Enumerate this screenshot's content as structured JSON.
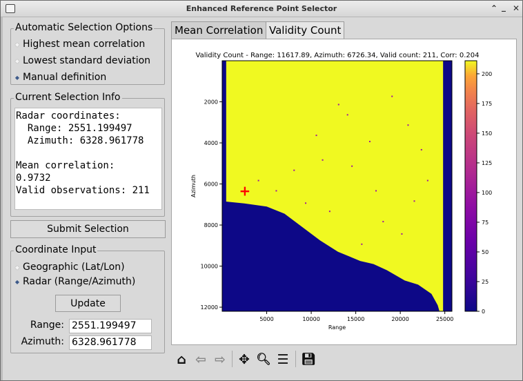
{
  "window": {
    "title": "Enhanced Reference Point Selector",
    "minimize": "⌃",
    "minimize2": "_",
    "close": "✕"
  },
  "auto_group": {
    "title": "Automatic Selection Options",
    "options": [
      {
        "label": "Highest mean correlation",
        "checked": false
      },
      {
        "label": "Lowest standard deviation",
        "checked": false
      },
      {
        "label": "Manual definition",
        "checked": true
      }
    ]
  },
  "info_group": {
    "title": "Current Selection Info",
    "lines": [
      "Radar coordinates:",
      "  Range: 2551.199497",
      "  Azimuth: 6328.961778",
      "",
      "Mean correlation:",
      "0.9732",
      "Valid observations: 211"
    ]
  },
  "submit_label": "Submit Selection",
  "coord_group": {
    "title": "Coordinate Input",
    "options": [
      {
        "label": "Geographic (Lat/Lon)",
        "checked": false
      },
      {
        "label": "Radar (Range/Azimuth)",
        "checked": true
      }
    ],
    "update_label": "Update",
    "range_label": "Range:",
    "range_value": "2551.199497",
    "azimuth_label": "Azimuth:",
    "azimuth_value": "6328.961778"
  },
  "tabs": [
    {
      "label": "Mean Correlation",
      "active": false
    },
    {
      "label": "Validity Count",
      "active": true
    }
  ],
  "plot": {
    "title": "Validity Count - Range: 11617.89, Azimuth: 6726.34, Valid count: 211, Corr: 0.204",
    "colormap": "plasma",
    "marker": {
      "range": 2551.2,
      "azimuth": 6329,
      "symbol": "+",
      "color": "#ff0000"
    }
  },
  "chart_data": {
    "type": "heatmap",
    "title": "Validity Count - Range: 11617.89, Azimuth: 6726.34, Valid count: 211, Corr: 0.204",
    "xlabel": "Range",
    "ylabel": "Azimuth",
    "xlim": [
      0,
      25800
    ],
    "ylim": [
      12200,
      0
    ],
    "x_ticks": [
      5000,
      10000,
      15000,
      20000,
      25000
    ],
    "y_ticks": [
      2000,
      4000,
      6000,
      8000,
      10000,
      12000
    ],
    "colorbar": {
      "range": [
        0,
        211
      ],
      "ticks": [
        0,
        25,
        50,
        75,
        100,
        125,
        150,
        175,
        200
      ]
    },
    "regions": [
      {
        "description": "valid area",
        "value": 211,
        "color": "#f0f921"
      },
      {
        "description": "invalid area (sea/borders)",
        "value": 0,
        "color": "#0d0887"
      }
    ],
    "coast_profile": [
      [
        300,
        6850
      ],
      [
        2500,
        6950
      ],
      [
        5000,
        7100
      ],
      [
        7000,
        7450
      ],
      [
        9000,
        8100
      ],
      [
        11000,
        8750
      ],
      [
        13000,
        9300
      ],
      [
        15500,
        9750
      ],
      [
        17000,
        9900
      ],
      [
        18500,
        10200
      ],
      [
        20500,
        10700
      ],
      [
        22000,
        10900
      ],
      [
        23500,
        11350
      ],
      [
        24200,
        11900
      ],
      [
        24400,
        12200
      ]
    ],
    "left_band_range": [
      0,
      450
    ],
    "right_band_range": [
      24800,
      25800
    ]
  },
  "toolbar": {
    "icons": [
      {
        "name": "home-icon",
        "glyph": "⌂"
      },
      {
        "name": "back-icon",
        "glyph": "⇦"
      },
      {
        "name": "forward-icon",
        "glyph": "⇨"
      },
      {
        "name": "pan-icon",
        "glyph": "✥"
      },
      {
        "name": "zoom-icon",
        "glyph": "🔍︎"
      },
      {
        "name": "configure-subplots-icon",
        "glyph": "☰"
      },
      {
        "name": "save-icon",
        "glyph": "💾︎"
      }
    ]
  }
}
